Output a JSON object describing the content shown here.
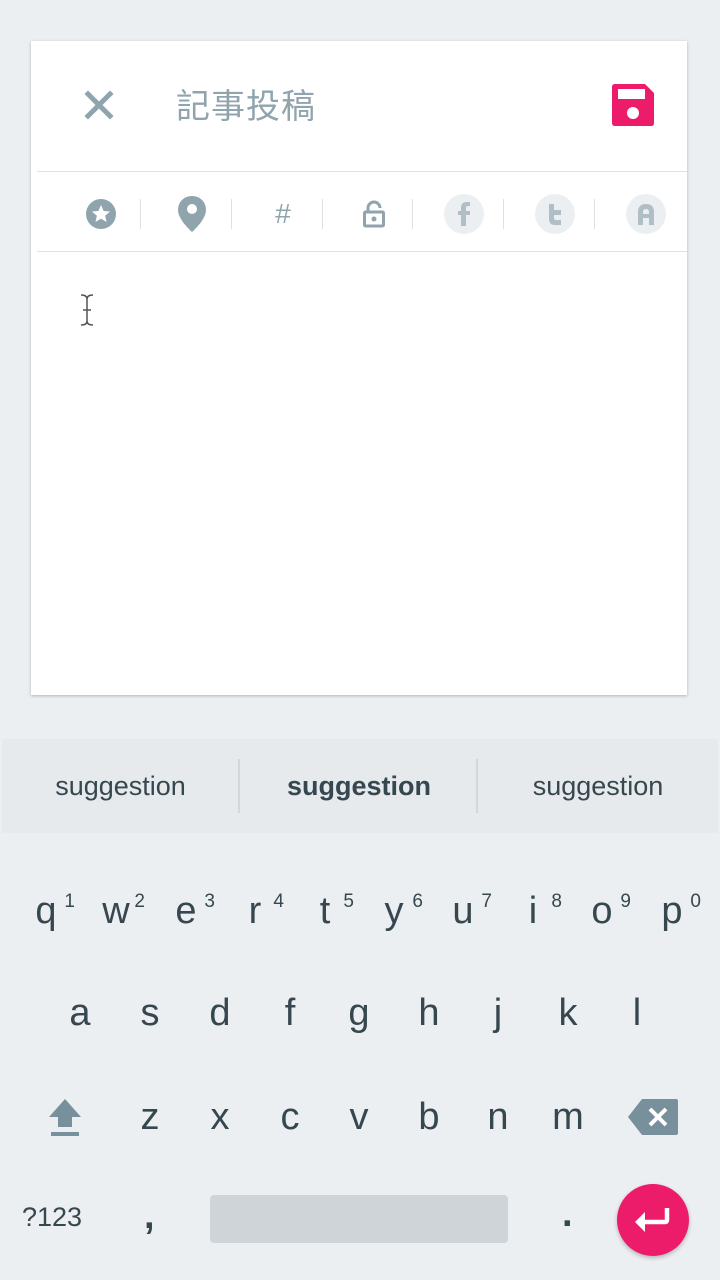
{
  "header": {
    "title": "記事投稿",
    "close_icon": "close-icon",
    "save_icon": "save-icon",
    "accent_color": "#ec1c6b"
  },
  "toolbar": {
    "icons": [
      "star-icon",
      "location-pin-icon",
      "hashtag-icon",
      "lock-icon",
      "facebook-icon",
      "twitter-icon",
      "ameba-icon"
    ],
    "hashtag_label": "#"
  },
  "editor": {
    "content": ""
  },
  "keyboard": {
    "suggestions": [
      "suggestion",
      "suggestion",
      "suggestion"
    ],
    "row1": [
      {
        "key": "q",
        "hint": "1"
      },
      {
        "key": "w",
        "hint": "2"
      },
      {
        "key": "e",
        "hint": "3"
      },
      {
        "key": "r",
        "hint": "4"
      },
      {
        "key": "t",
        "hint": "5"
      },
      {
        "key": "y",
        "hint": "6"
      },
      {
        "key": "u",
        "hint": "7"
      },
      {
        "key": "i",
        "hint": "8"
      },
      {
        "key": "o",
        "hint": "9"
      },
      {
        "key": "p",
        "hint": "0"
      }
    ],
    "row2": [
      "a",
      "s",
      "d",
      "f",
      "g",
      "h",
      "j",
      "k",
      "l"
    ],
    "row3": [
      "z",
      "x",
      "c",
      "v",
      "b",
      "n",
      "m"
    ],
    "symbols_label": "?123",
    "comma_label": ",",
    "period_label": ".",
    "enter_color": "#ec1c6b"
  }
}
